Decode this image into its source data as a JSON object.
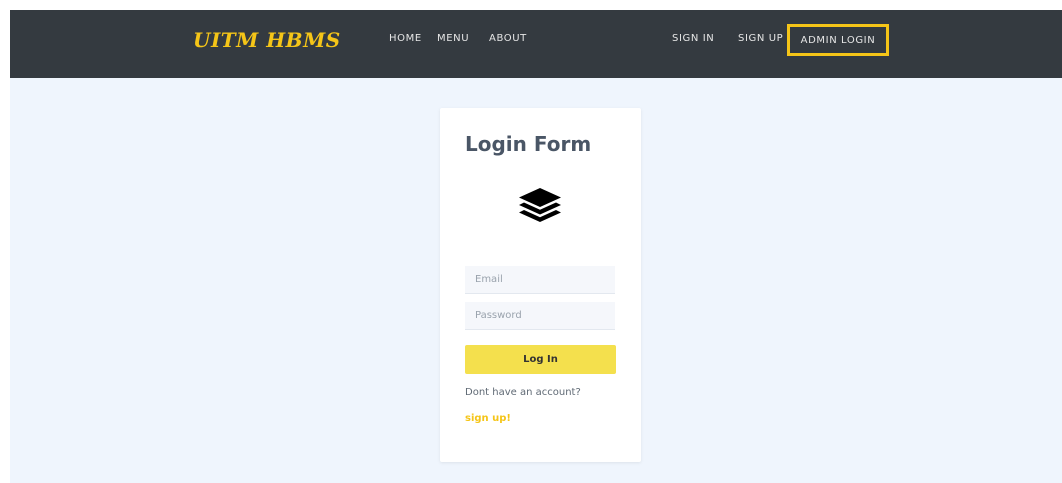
{
  "navbar": {
    "brand": "UITM HBMS",
    "links": [
      "HOME",
      "MENU",
      "ABOUT"
    ],
    "right_links": [
      "SIGN IN",
      "SIGN UP",
      "ADMIN LOGIN"
    ],
    "highlight_color": "#f5c518"
  },
  "login_form": {
    "title": "Login Form",
    "logo_icon": "layers-icon",
    "email_placeholder": "Email",
    "password_placeholder": "Password",
    "submit_label": "Log In",
    "no_account_text": "Dont have an account?",
    "signup_link": "sign up!"
  },
  "colors": {
    "navbar_bg": "#343a40",
    "page_bg": "#eff5fd",
    "button_bg": "#f4e04d",
    "accent": "#f5c518"
  }
}
